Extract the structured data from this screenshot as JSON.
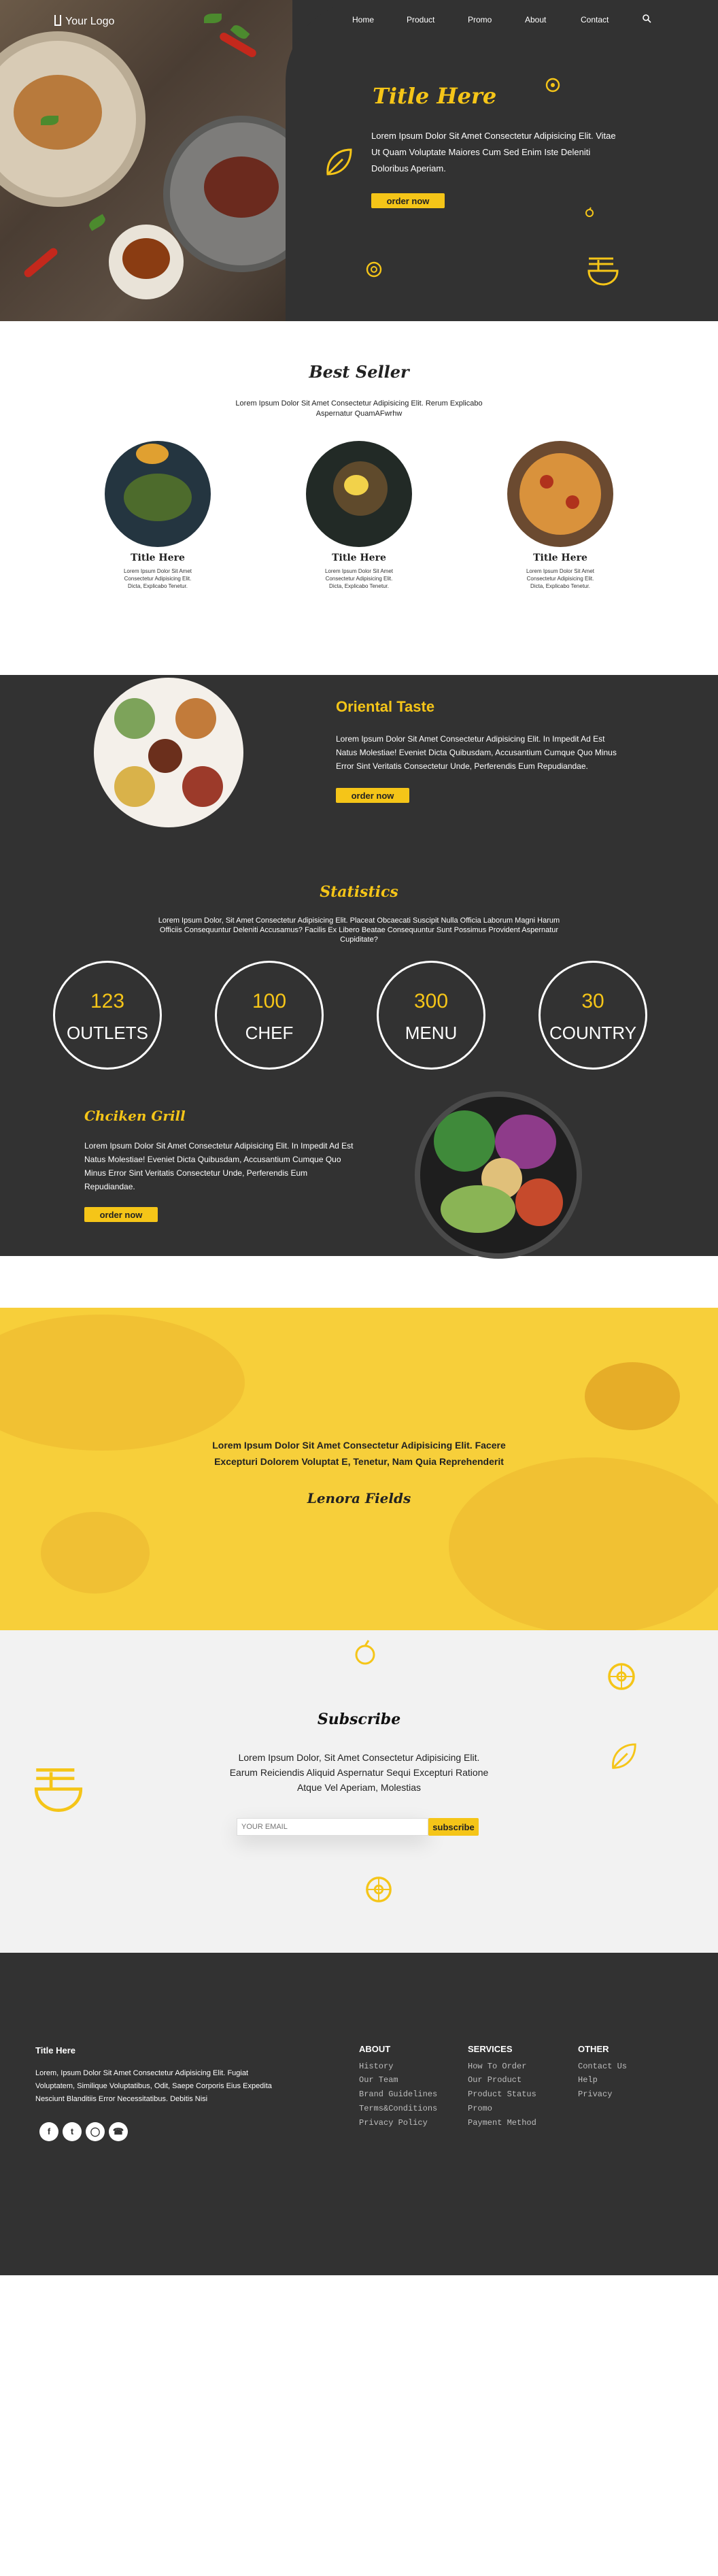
{
  "header": {
    "logo_text": "Your Logo",
    "nav": [
      "Home",
      "Product",
      "Promo",
      "About",
      "Contact"
    ]
  },
  "hero": {
    "title": "Title Here",
    "text": "Lorem Ipsum Dolor Sit Amet Consectetur Adipisicing Elit. Vitae Ut Quam Voluptate Maiores Cum Sed Enim Iste Deleniti Doloribus Aperiam.",
    "button": "order now"
  },
  "best_seller": {
    "title": "Best Seller",
    "subtitle": "Lorem Ipsum Dolor Sit Amet Consectetur Adipisicing Elit. Rerum Explicabo Aspernatur QuamAFwrhw",
    "items": [
      {
        "title": "Title Here",
        "text": "Lorem Ipsum Dolor Sit Amet Consectetur Adipisicing Elit. Dicta, Explicabo Tenetur."
      },
      {
        "title": "Title Here",
        "text": "Lorem Ipsum Dolor Sit Amet Consectetur Adipisicing Elit. Dicta, Explicabo Tenetur."
      },
      {
        "title": "Title Here",
        "text": "Lorem Ipsum Dolor Sit Amet Consectetur Adipisicing Elit. Dicta, Explicabo Tenetur."
      }
    ]
  },
  "oriental": {
    "title": "Oriental Taste",
    "text": "Lorem Ipsum Dolor Sit Amet Consectetur Adipisicing Elit. In Impedit Ad Est Natus Molestiae! Eveniet Dicta Quibusdam, Accusantium Cumque Quo Minus Error Sint Veritatis Consectetur Unde, Perferendis Eum Repudiandae.",
    "button": "order now"
  },
  "statistics": {
    "title": "Statistics",
    "text": "Lorem Ipsum Dolor, Sit Amet Consectetur Adipisicing Elit. Placeat Obcaecati Suscipit Nulla Officia Laborum Magni Harum Officiis Consequuntur Deleniti Accusamus? Facilis Ex Libero Beatae Consequuntur Sunt Possimus Provident Aspernatur Cupiditate?",
    "items": [
      {
        "value": "123",
        "label": "OUTLETS"
      },
      {
        "value": "100",
        "label": "CHEF"
      },
      {
        "value": "300",
        "label": "MENU"
      },
      {
        "value": "30",
        "label": "COUNTRY"
      }
    ]
  },
  "chicken": {
    "title": "Chciken Grill",
    "text": "Lorem Ipsum Dolor Sit Amet Consectetur Adipisicing Elit. In Impedit Ad Est Natus Molestiae! Eveniet Dicta Quibusdam, Accusantium Cumque Quo Minus Error Sint Veritatis Consectetur Unde, Perferendis Eum Repudiandae.",
    "button": "order now"
  },
  "testimonial": {
    "quote": "Lorem Ipsum Dolor Sit Amet Consectetur Adipisicing Elit. Facere Excepturi Dolorem Voluptat E, Tenetur, Nam Quia Reprehenderit",
    "author": "Lenora Fields"
  },
  "subscribe": {
    "title": "Subscribe",
    "text": "Lorem Ipsum Dolor, Sit Amet Consectetur Adipisicing Elit. Earum Reiciendis Aliquid Aspernatur Sequi Excepturi Ratione Atque Vel Aperiam, Molestias",
    "placeholder": "YOUR EMAIL",
    "button": "subscribe"
  },
  "footer": {
    "title": "Title Here",
    "text": "Lorem, Ipsum Dolor Sit Amet Consectetur Adipisicing Elit. Fugiat Voluptatem, Similique Voluptatibus, Odit, Saepe Corporis Eius Expedita Nesciunt Blanditiis Error Necessitatibus. Debitis Nisi",
    "columns": [
      {
        "head": "ABOUT",
        "links": [
          "History",
          "Our Team",
          "Brand Guidelines",
          "Terms&Conditions",
          "Privacy Policy"
        ]
      },
      {
        "head": "SERVICES",
        "links": [
          "How To Order",
          "Our Product",
          "Product Status",
          "Promo",
          "Payment Method"
        ]
      },
      {
        "head": "OTHER",
        "links": [
          "Contact Us",
          "Help",
          "Privacy"
        ]
      }
    ]
  },
  "colors": {
    "accent": "#f5c518",
    "dark": "#323232",
    "light_gray": "#f2f2f2"
  },
  "icons": [
    "search-icon",
    "leaf-icon",
    "cookie-icon",
    "noodle-bowl-icon",
    "apple-icon",
    "lemon-slice-icon",
    "facebook-icon",
    "twitter-icon",
    "instagram-icon",
    "whatsapp-icon"
  ]
}
